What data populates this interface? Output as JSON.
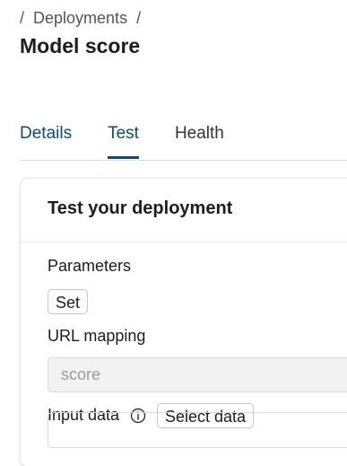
{
  "breadcrumb": {
    "separator": "/",
    "items": [
      {
        "label": "Deployments"
      }
    ]
  },
  "page": {
    "title": "Model score"
  },
  "tabs": [
    {
      "label": "Details",
      "active": false
    },
    {
      "label": "Test",
      "active": true
    },
    {
      "label": "Health",
      "active": false
    }
  ],
  "test_card": {
    "title": "Test your deployment",
    "parameters": {
      "label": "Parameters",
      "button_label": "Set"
    },
    "url_mapping": {
      "label": "URL mapping",
      "value": "score"
    },
    "input_data": {
      "label": "Input data",
      "info_icon": "info-circle-icon",
      "button_label": "Select data"
    }
  },
  "colors": {
    "accent": "#0f4c6b",
    "text": "#1d1d1d",
    "muted": "#555555"
  }
}
